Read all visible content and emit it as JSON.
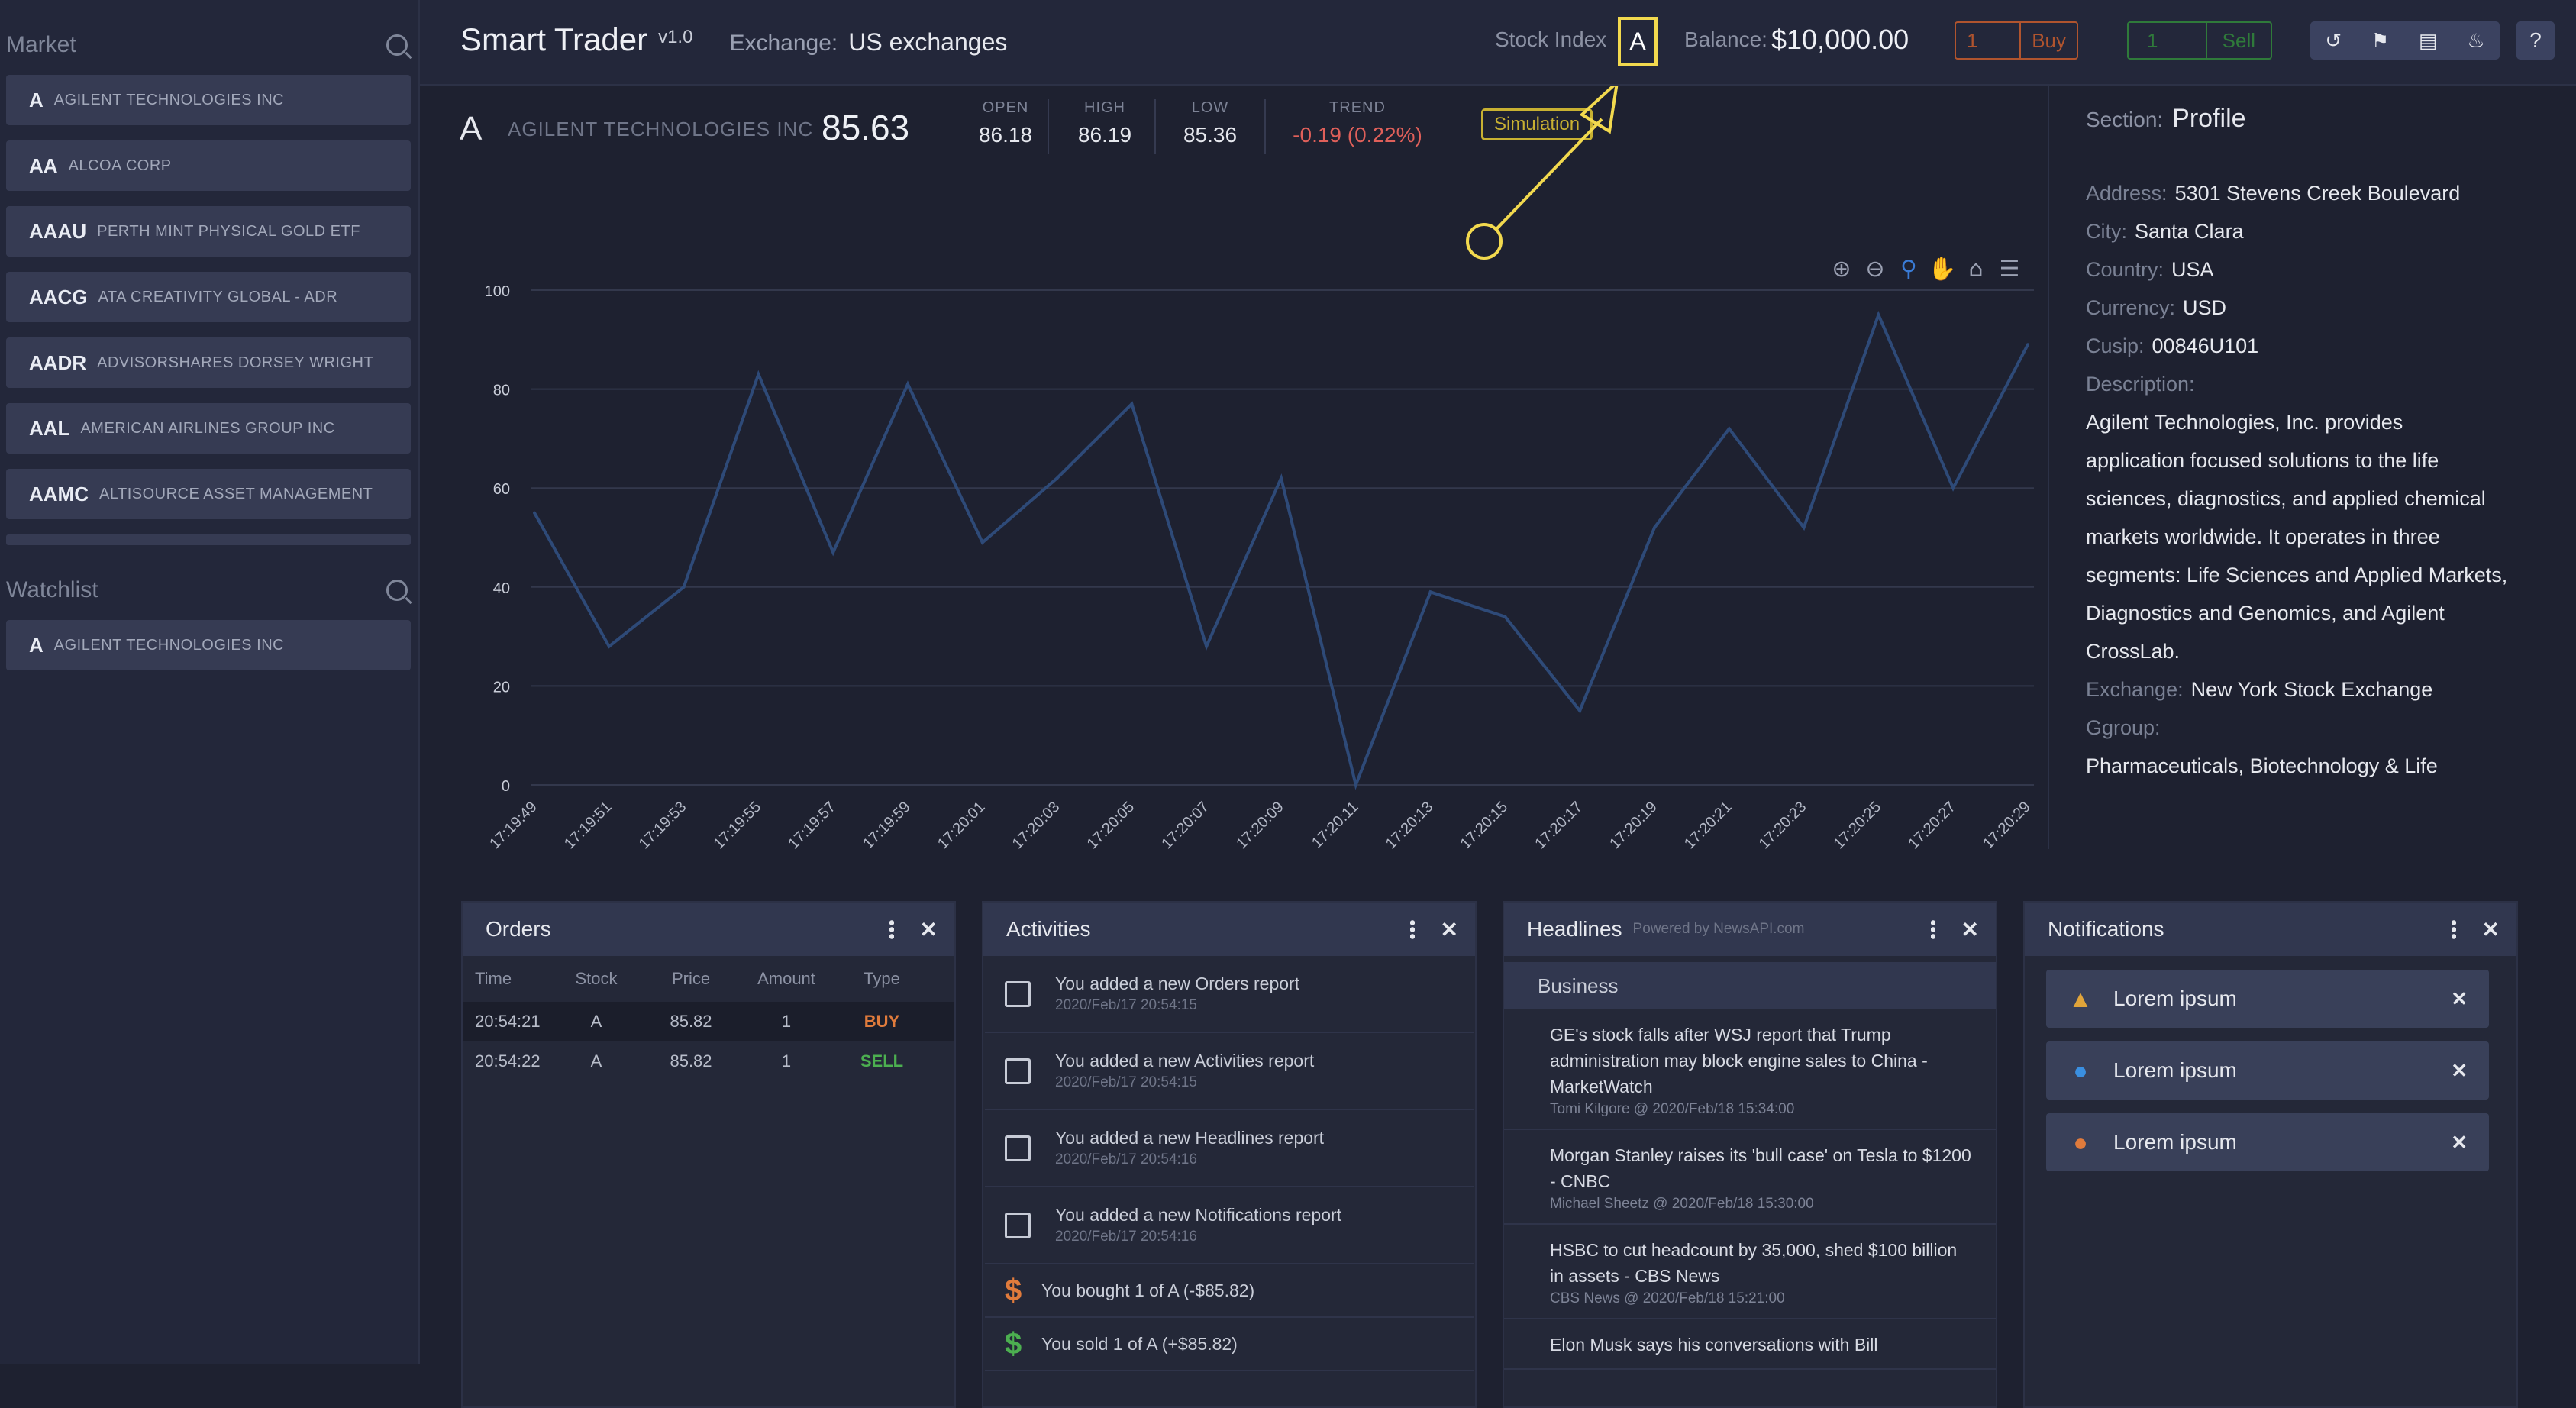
{
  "app": {
    "title": "Smart Trader",
    "version": "v1.0",
    "exchange_label": "Exchange:",
    "exchange_value": "US exchanges"
  },
  "header": {
    "stock_index_label": "Stock Index",
    "stock_index_value": "A",
    "balance_label": "Balance:",
    "balance_value": "$10,000.00",
    "buy_qty": "1",
    "buy_label": "Buy",
    "sell_qty": "1",
    "sell_label": "Sell",
    "icons": [
      "history-icon",
      "flag-icon",
      "newspaper-icon",
      "bell-icon",
      "help-icon"
    ]
  },
  "sidebar": {
    "market_title": "Market",
    "market_items": [
      {
        "symbol": "A",
        "name": "AGILENT TECHNOLOGIES INC"
      },
      {
        "symbol": "AA",
        "name": "ALCOA CORP"
      },
      {
        "symbol": "AAAU",
        "name": "PERTH MINT PHYSICAL GOLD ETF"
      },
      {
        "symbol": "AACG",
        "name": "ATA CREATIVITY GLOBAL - ADR"
      },
      {
        "symbol": "AADR",
        "name": "ADVISORSHARES DORSEY WRIGHT"
      },
      {
        "symbol": "AAL",
        "name": "AMERICAN AIRLINES GROUP INC"
      },
      {
        "symbol": "AAMC",
        "name": "ALTISOURCE ASSET MANAGEMENT"
      }
    ],
    "watchlist_title": "Watchlist",
    "watchlist_items": [
      {
        "symbol": "A",
        "name": "AGILENT TECHNOLOGIES INC"
      }
    ]
  },
  "quote": {
    "symbol": "A",
    "company": "AGILENT TECHNOLOGIES INC",
    "price": "85.63",
    "open_label": "OPEN",
    "open": "86.18",
    "high_label": "HIGH",
    "high": "86.19",
    "low_label": "LOW",
    "low": "85.36",
    "trend_label": "TREND",
    "trend": "-0.19 (0.22%)",
    "badge": "Simulation",
    "trend_color": "#e0605a"
  },
  "chart_data": {
    "type": "line",
    "categories": [
      "17:19:49",
      "17:19:51",
      "17:19:53",
      "17:19:55",
      "17:19:57",
      "17:19:59",
      "17:20:01",
      "17:20:03",
      "17:20:05",
      "17:20:07",
      "17:20:09",
      "17:20:11",
      "17:20:13",
      "17:20:15",
      "17:20:17",
      "17:20:19",
      "17:20:21",
      "17:20:23",
      "17:20:25",
      "17:20:27",
      "17:20:29"
    ],
    "values": [
      55,
      28,
      40,
      83,
      47,
      81,
      49,
      62,
      77,
      28,
      62,
      0,
      39,
      34,
      15,
      52,
      72,
      52,
      95,
      60,
      89
    ],
    "yticks": [
      0,
      20,
      40,
      60,
      80,
      100
    ],
    "ylim": [
      0,
      100
    ],
    "grid": true,
    "line_color": "#2e4a78",
    "toolbar_icons": [
      "zoom-in-icon",
      "zoom-out-icon",
      "magnify-icon",
      "pan-hand-icon",
      "home-icon",
      "menu-icon"
    ]
  },
  "profile": {
    "section_label": "Section:",
    "section_value": "Profile",
    "fields": [
      {
        "k": "Address:",
        "v": "5301 Stevens Creek Boulevard"
      },
      {
        "k": "City:",
        "v": "Santa Clara"
      },
      {
        "k": "Country:",
        "v": "USA"
      },
      {
        "k": "Currency:",
        "v": "USD"
      },
      {
        "k": "Cusip:",
        "v": "00846U101"
      }
    ],
    "description_label": "Description:",
    "description_lines": [
      "Agilent Technologies, Inc. provides",
      "application focused solutions to the life",
      "sciences, diagnostics, and applied chemical",
      "markets worldwide. It operates in three",
      "segments: Life Sciences and Applied Markets,",
      "Diagnostics and Genomics, and Agilent",
      "CrossLab."
    ],
    "exchange_label": "Exchange:",
    "exchange_value": "New York Stock Exchange",
    "group_label": "Ggroup:",
    "group_value": "Pharmaceuticals, Biotechnology & Life"
  },
  "orders": {
    "title": "Orders",
    "columns": [
      "Time",
      "Stock",
      "Price",
      "Amount",
      "Type"
    ],
    "rows": [
      {
        "time": "20:54:21",
        "stock": "A",
        "price": "85.82",
        "amount": "1",
        "type": "BUY"
      },
      {
        "time": "20:54:22",
        "stock": "A",
        "price": "85.82",
        "amount": "1",
        "type": "SELL"
      }
    ],
    "buy_color": "#e07b3c",
    "sell_color": "#4caf50"
  },
  "activities": {
    "title": "Activities",
    "items": [
      {
        "text": "You added a new Orders report",
        "time": "2020/Feb/17 20:54:15"
      },
      {
        "text": "You added a new Activities report",
        "time": "2020/Feb/17 20:54:15"
      },
      {
        "text": "You added a new Headlines report",
        "time": "2020/Feb/17 20:54:16"
      },
      {
        "text": "You added a new Notifications report",
        "time": "2020/Feb/17 20:54:16"
      }
    ],
    "trades": [
      {
        "text": "You bought 1 of A (-$85.82)",
        "color": "#e07b3c"
      },
      {
        "text": "You sold 1 of A (+$85.82)",
        "color": "#4caf50"
      }
    ]
  },
  "headlines": {
    "title": "Headlines",
    "powered": "Powered by NewsAPI.com",
    "category": "Business",
    "items": [
      {
        "title": "GE's stock falls after WSJ report that Trump administration may block engine sales to China - MarketWatch",
        "meta": "Tomi Kilgore @ 2020/Feb/18 15:34:00"
      },
      {
        "title": "Morgan Stanley raises its 'bull case' on Tesla to $1200 - CNBC",
        "meta": "Michael Sheetz @ 2020/Feb/18 15:30:00"
      },
      {
        "title": "HSBC to cut headcount by 35,000, shed $100 billion in assets - CBS News",
        "meta": "CBS News @ 2020/Feb/18 15:21:00"
      },
      {
        "title": "Elon Musk says his conversations with Bill",
        "meta": ""
      }
    ]
  },
  "notifications": {
    "title": "Notifications",
    "items": [
      {
        "text": "Lorem ipsum",
        "icon": "warning-icon",
        "color": "#e0a43a"
      },
      {
        "text": "Lorem ipsum",
        "icon": "info-icon",
        "color": "#3a8fe0"
      },
      {
        "text": "Lorem ipsum",
        "icon": "error-icon",
        "color": "#e07b3c"
      }
    ]
  }
}
